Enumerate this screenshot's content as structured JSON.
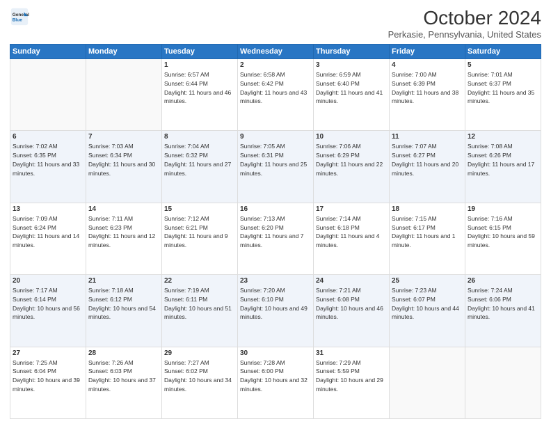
{
  "header": {
    "logo_line1": "General",
    "logo_line2": "Blue",
    "title": "October 2024",
    "subtitle": "Perkasie, Pennsylvania, United States"
  },
  "columns": [
    "Sunday",
    "Monday",
    "Tuesday",
    "Wednesday",
    "Thursday",
    "Friday",
    "Saturday"
  ],
  "weeks": [
    [
      {
        "day": "",
        "info": ""
      },
      {
        "day": "",
        "info": ""
      },
      {
        "day": "1",
        "info": "Sunrise: 6:57 AM\nSunset: 6:44 PM\nDaylight: 11 hours and 46 minutes."
      },
      {
        "day": "2",
        "info": "Sunrise: 6:58 AM\nSunset: 6:42 PM\nDaylight: 11 hours and 43 minutes."
      },
      {
        "day": "3",
        "info": "Sunrise: 6:59 AM\nSunset: 6:40 PM\nDaylight: 11 hours and 41 minutes."
      },
      {
        "day": "4",
        "info": "Sunrise: 7:00 AM\nSunset: 6:39 PM\nDaylight: 11 hours and 38 minutes."
      },
      {
        "day": "5",
        "info": "Sunrise: 7:01 AM\nSunset: 6:37 PM\nDaylight: 11 hours and 35 minutes."
      }
    ],
    [
      {
        "day": "6",
        "info": "Sunrise: 7:02 AM\nSunset: 6:35 PM\nDaylight: 11 hours and 33 minutes."
      },
      {
        "day": "7",
        "info": "Sunrise: 7:03 AM\nSunset: 6:34 PM\nDaylight: 11 hours and 30 minutes."
      },
      {
        "day": "8",
        "info": "Sunrise: 7:04 AM\nSunset: 6:32 PM\nDaylight: 11 hours and 27 minutes."
      },
      {
        "day": "9",
        "info": "Sunrise: 7:05 AM\nSunset: 6:31 PM\nDaylight: 11 hours and 25 minutes."
      },
      {
        "day": "10",
        "info": "Sunrise: 7:06 AM\nSunset: 6:29 PM\nDaylight: 11 hours and 22 minutes."
      },
      {
        "day": "11",
        "info": "Sunrise: 7:07 AM\nSunset: 6:27 PM\nDaylight: 11 hours and 20 minutes."
      },
      {
        "day": "12",
        "info": "Sunrise: 7:08 AM\nSunset: 6:26 PM\nDaylight: 11 hours and 17 minutes."
      }
    ],
    [
      {
        "day": "13",
        "info": "Sunrise: 7:09 AM\nSunset: 6:24 PM\nDaylight: 11 hours and 14 minutes."
      },
      {
        "day": "14",
        "info": "Sunrise: 7:11 AM\nSunset: 6:23 PM\nDaylight: 11 hours and 12 minutes."
      },
      {
        "day": "15",
        "info": "Sunrise: 7:12 AM\nSunset: 6:21 PM\nDaylight: 11 hours and 9 minutes."
      },
      {
        "day": "16",
        "info": "Sunrise: 7:13 AM\nSunset: 6:20 PM\nDaylight: 11 hours and 7 minutes."
      },
      {
        "day": "17",
        "info": "Sunrise: 7:14 AM\nSunset: 6:18 PM\nDaylight: 11 hours and 4 minutes."
      },
      {
        "day": "18",
        "info": "Sunrise: 7:15 AM\nSunset: 6:17 PM\nDaylight: 11 hours and 1 minute."
      },
      {
        "day": "19",
        "info": "Sunrise: 7:16 AM\nSunset: 6:15 PM\nDaylight: 10 hours and 59 minutes."
      }
    ],
    [
      {
        "day": "20",
        "info": "Sunrise: 7:17 AM\nSunset: 6:14 PM\nDaylight: 10 hours and 56 minutes."
      },
      {
        "day": "21",
        "info": "Sunrise: 7:18 AM\nSunset: 6:12 PM\nDaylight: 10 hours and 54 minutes."
      },
      {
        "day": "22",
        "info": "Sunrise: 7:19 AM\nSunset: 6:11 PM\nDaylight: 10 hours and 51 minutes."
      },
      {
        "day": "23",
        "info": "Sunrise: 7:20 AM\nSunset: 6:10 PM\nDaylight: 10 hours and 49 minutes."
      },
      {
        "day": "24",
        "info": "Sunrise: 7:21 AM\nSunset: 6:08 PM\nDaylight: 10 hours and 46 minutes."
      },
      {
        "day": "25",
        "info": "Sunrise: 7:23 AM\nSunset: 6:07 PM\nDaylight: 10 hours and 44 minutes."
      },
      {
        "day": "26",
        "info": "Sunrise: 7:24 AM\nSunset: 6:06 PM\nDaylight: 10 hours and 41 minutes."
      }
    ],
    [
      {
        "day": "27",
        "info": "Sunrise: 7:25 AM\nSunset: 6:04 PM\nDaylight: 10 hours and 39 minutes."
      },
      {
        "day": "28",
        "info": "Sunrise: 7:26 AM\nSunset: 6:03 PM\nDaylight: 10 hours and 37 minutes."
      },
      {
        "day": "29",
        "info": "Sunrise: 7:27 AM\nSunset: 6:02 PM\nDaylight: 10 hours and 34 minutes."
      },
      {
        "day": "30",
        "info": "Sunrise: 7:28 AM\nSunset: 6:00 PM\nDaylight: 10 hours and 32 minutes."
      },
      {
        "day": "31",
        "info": "Sunrise: 7:29 AM\nSunset: 5:59 PM\nDaylight: 10 hours and 29 minutes."
      },
      {
        "day": "",
        "info": ""
      },
      {
        "day": "",
        "info": ""
      }
    ]
  ]
}
